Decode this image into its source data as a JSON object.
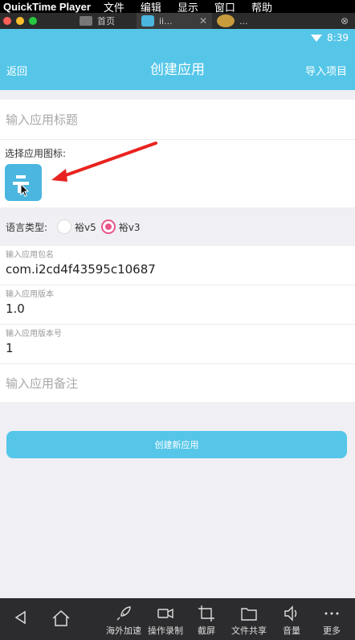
{
  "mac_menubar": {
    "app_name": "QuickTime Player",
    "menus": [
      "文件",
      "编辑",
      "显示",
      "窗口",
      "帮助"
    ]
  },
  "tabs": [
    {
      "label": "首页"
    },
    {
      "label": "ii..."
    },
    {
      "label": "..."
    }
  ],
  "status_bar": {
    "time": "8:39"
  },
  "titlebar": {
    "back": "返回",
    "title": "创建应用",
    "import": "导入项目"
  },
  "form": {
    "title_placeholder": "输入应用标题",
    "icon_label": "选择应用图标:",
    "language_label": "语言类型:",
    "lang_options": [
      {
        "label": "裕v5",
        "checked": false
      },
      {
        "label": "裕v3",
        "checked": true
      }
    ],
    "package": {
      "label": "输入应用包名",
      "value": "com.i2cd4f43595c10687"
    },
    "version": {
      "label": "输入应用版本",
      "value": "1.0"
    },
    "version_code": {
      "label": "输入应用版本号",
      "value": "1"
    },
    "remark_placeholder": "输入应用备注",
    "create_button": "创建新应用"
  },
  "bottom_nav": {
    "speedup": "海外加速",
    "record": "操作录制",
    "screenshot": "截屏",
    "file_share": "文件共享",
    "volume": "音量",
    "more": "更多"
  },
  "colors": {
    "accent": "#55c6e8",
    "radio_checked": "#e9558a",
    "arrow": "#e8231f"
  }
}
